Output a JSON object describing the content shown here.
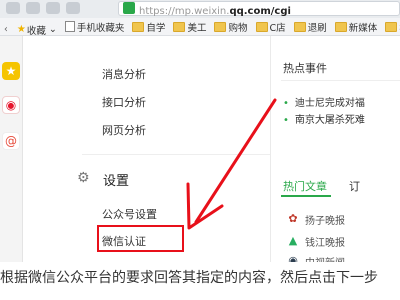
{
  "browser": {
    "url_highlight": "",
    "url_prefix": "https://mp.weixin.",
    "url_domain": "qq.com/cgi"
  },
  "bookmarks": [
    {
      "label": "收藏",
      "icon": "star-icon"
    },
    {
      "label": "手机收藏夹",
      "icon": "doc-icon"
    },
    {
      "label": "自学",
      "icon": "folder-icon"
    },
    {
      "label": "美工",
      "icon": "folder-icon"
    },
    {
      "label": "购物",
      "icon": "folder-icon"
    },
    {
      "label": "C店",
      "icon": "folder-icon"
    },
    {
      "label": "退刷",
      "icon": "folder-icon"
    },
    {
      "label": "新媒体",
      "icon": "folder-icon"
    },
    {
      "label": "华",
      "icon": "folder-icon"
    }
  ],
  "menu": {
    "items_top": [
      "消息分析",
      "接口分析",
      "网页分析"
    ],
    "section_title": "设置",
    "items_settings": [
      "公众号设置",
      "微信认证"
    ]
  },
  "right": {
    "hot_title": "热点事件",
    "hot_items": [
      "迪士尼完成对福",
      "南京大屠杀死难"
    ],
    "tabs": [
      "热门文章",
      "订"
    ],
    "sources": [
      "扬子晚报",
      "钱江晚报",
      "中视新闻"
    ]
  },
  "caption": "根据微信公众平台的要求回答其指定的内容，然后点击下一步"
}
